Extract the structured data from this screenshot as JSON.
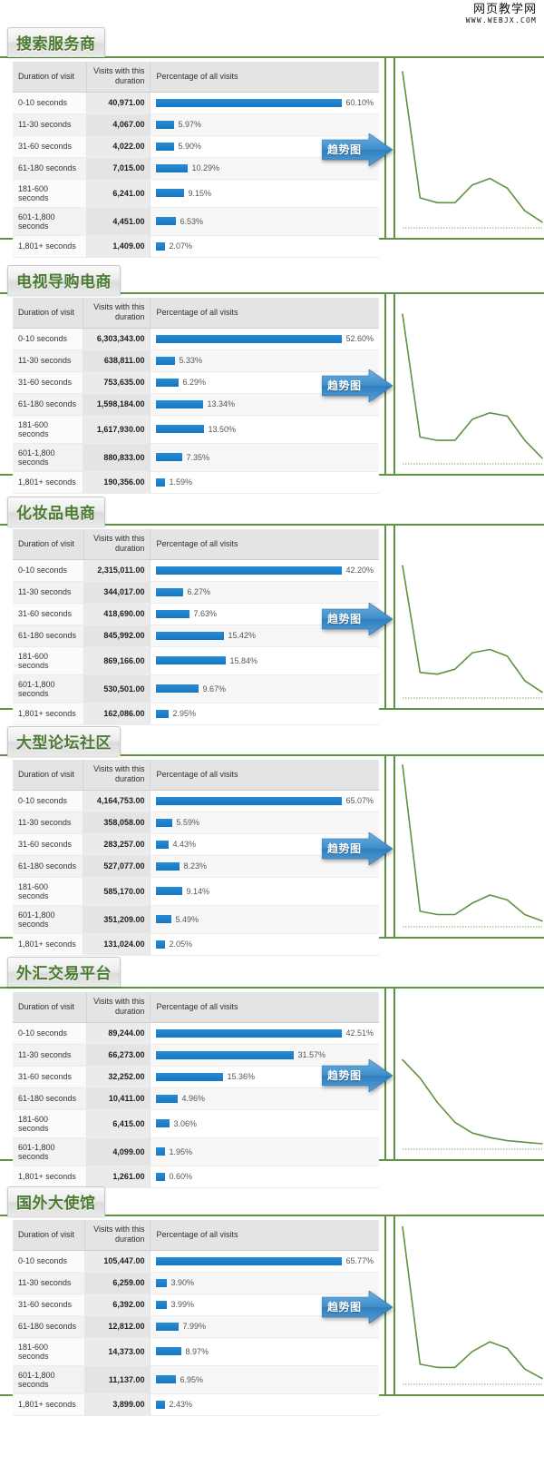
{
  "watermark": {
    "cn": "网页教学网",
    "url": "WWW.WEBJX.COM"
  },
  "table_headers": {
    "duration": "Duration of visit",
    "visits": "Visits with this duration",
    "percentage": "Percentage of all visits"
  },
  "arrow_label": "趋势图",
  "colors": {
    "bar": "#1a7ec8",
    "border_green": "#5f9243",
    "title_green": "#4b7a33",
    "spark_line": "#5f9243",
    "arrow_blue": "#3b87c8"
  },
  "chart_data": [
    {
      "type": "bar",
      "title": "搜索服务商",
      "xlabel": "Percentage of all visits",
      "ylabel": "Duration of visit",
      "categories": [
        "0-10 seconds",
        "11-30 seconds",
        "31-60 seconds",
        "61-180 seconds",
        "181-600 seconds",
        "601-1,800 seconds",
        "1,801+ seconds"
      ],
      "visits": [
        "40,971.00",
        "4,067.00",
        "4,022.00",
        "7,015.00",
        "6,241.00",
        "4,451.00",
        "1,409.00"
      ],
      "values": [
        60.1,
        5.97,
        5.9,
        10.29,
        9.15,
        6.53,
        2.07
      ],
      "value_labels": [
        "60.10%",
        "5.97%",
        "5.90%",
        "10.29%",
        "9.15%",
        "6.53%",
        "2.07%"
      ],
      "sparkline": [
        96,
        18,
        15,
        15,
        26,
        30,
        24,
        10,
        3
      ]
    },
    {
      "type": "bar",
      "title": "电视导购电商",
      "xlabel": "Percentage of all visits",
      "ylabel": "Duration of visit",
      "categories": [
        "0-10 seconds",
        "11-30 seconds",
        "31-60 seconds",
        "61-180 seconds",
        "181-600 seconds",
        "601-1,800 seconds",
        "1,801+ seconds"
      ],
      "visits": [
        "6,303,343.00",
        "638,811.00",
        "753,635.00",
        "1,598,184.00",
        "1,617,930.00",
        "880,833.00",
        "190,356.00"
      ],
      "values": [
        52.6,
        5.33,
        6.29,
        13.34,
        13.5,
        7.35,
        1.59
      ],
      "value_labels": [
        "52.60%",
        "5.33%",
        "6.29%",
        "13.34%",
        "13.50%",
        "7.35%",
        "1.59%"
      ],
      "sparkline": [
        92,
        16,
        14,
        14,
        27,
        31,
        29,
        14,
        3
      ]
    },
    {
      "type": "bar",
      "title": "化妆品电商",
      "xlabel": "Percentage of all visits",
      "ylabel": "Duration of visit",
      "categories": [
        "0-10 seconds",
        "11-30 seconds",
        "31-60 seconds",
        "61-180 seconds",
        "181-600 seconds",
        "601-1,800 seconds",
        "1,801+ seconds"
      ],
      "visits": [
        "2,315,011.00",
        "344,017.00",
        "418,690.00",
        "845,992.00",
        "869,166.00",
        "530,501.00",
        "162,086.00"
      ],
      "values": [
        42.2,
        6.27,
        7.63,
        15.42,
        15.84,
        9.67,
        2.95
      ],
      "value_labels": [
        "42.20%",
        "6.27%",
        "7.63%",
        "15.42%",
        "15.84%",
        "9.67%",
        "2.95%"
      ],
      "sparkline": [
        80,
        15,
        14,
        17,
        27,
        29,
        25,
        10,
        3
      ]
    },
    {
      "type": "bar",
      "title": "大型论坛社区",
      "xlabel": "Percentage of all visits",
      "ylabel": "Duration of visit",
      "categories": [
        "0-10 seconds",
        "11-30 seconds",
        "31-60 seconds",
        "61-180 seconds",
        "181-600 seconds",
        "601-1,800 seconds",
        "1,801+ seconds"
      ],
      "visits": [
        "4,164,753.00",
        "358,058.00",
        "283,257.00",
        "527,077.00",
        "585,170.00",
        "351,209.00",
        "131,024.00"
      ],
      "values": [
        65.07,
        5.59,
        4.43,
        8.23,
        9.14,
        5.49,
        2.05
      ],
      "value_labels": [
        "65.07%",
        "5.59%",
        "4.43%",
        "8.23%",
        "9.14%",
        "5.49%",
        "2.05%"
      ],
      "sparkline": [
        99,
        9,
        7,
        7,
        14,
        19,
        16,
        7,
        3
      ]
    },
    {
      "type": "bar",
      "title": "外汇交易平台",
      "xlabel": "Percentage of all visits",
      "ylabel": "Duration of visit",
      "categories": [
        "0-10 seconds",
        "11-30 seconds",
        "31-60 seconds",
        "61-180 seconds",
        "181-600 seconds",
        "601-1,800 seconds",
        "1,801+ seconds"
      ],
      "visits": [
        "89,244.00",
        "66,273.00",
        "32,252.00",
        "10,411.00",
        "6,415.00",
        "4,099.00",
        "1,261.00"
      ],
      "values": [
        42.51,
        31.57,
        15.36,
        4.96,
        3.06,
        1.95,
        0.6
      ],
      "value_labels": [
        "42.51%",
        "31.57%",
        "15.36%",
        "4.96%",
        "3.06%",
        "1.95%",
        "0.60%"
      ],
      "sparkline": [
        58,
        46,
        30,
        17,
        10,
        7,
        5,
        4,
        3
      ]
    },
    {
      "type": "bar",
      "title": "国外大使馆",
      "xlabel": "Percentage of all visits",
      "ylabel": "Duration of visit",
      "categories": [
        "0-10 seconds",
        "11-30 seconds",
        "31-60 seconds",
        "61-180 seconds",
        "181-600 seconds",
        "601-1,800 seconds",
        "1,801+ seconds"
      ],
      "visits": [
        "105,447.00",
        "6,259.00",
        "6,392.00",
        "12,812.00",
        "14,373.00",
        "11,137.00",
        "3,899.00"
      ],
      "values": [
        65.77,
        3.9,
        3.99,
        7.99,
        8.97,
        6.95,
        2.43
      ],
      "value_labels": [
        "65.77%",
        "3.90%",
        "3.99%",
        "7.99%",
        "8.97%",
        "6.95%",
        "2.43%"
      ],
      "sparkline": [
        98,
        12,
        10,
        10,
        20,
        26,
        22,
        9,
        3
      ]
    }
  ]
}
